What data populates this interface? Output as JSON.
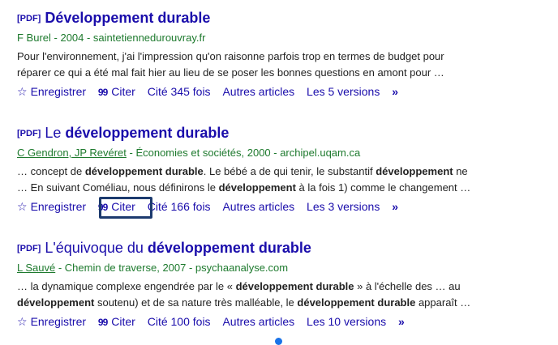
{
  "results": [
    {
      "pdf_tag": "[PDF]",
      "title_bold": "Développement durable",
      "meta_authors": "F Burel",
      "meta_rest": " - 2004 - saintetiennedurouvray.fr",
      "snippet_line1": "Pour l'environnement, j'ai l'impression qu'on raisonne parfois trop en termes de budget pour",
      "snippet_line2": "réparer ce qui a été mal fait hier au lieu de se poser les bonnes questions en amont pour …",
      "actions": {
        "save": "Enregistrer",
        "cite": "Citer",
        "cited_by": "Cité 345 fois",
        "related": "Autres articles",
        "versions": "Les 5 versions"
      }
    },
    {
      "pdf_tag": "[PDF]",
      "title_pre": "Le ",
      "title_bold": "développement durable",
      "meta_authors": "C Gendron, JP Revéret",
      "meta_rest": " - Économies et sociétés, 2000 - archipel.uqam.ca",
      "snippet_l1_a": "… concept de ",
      "snippet_l1_b": "développement durable",
      "snippet_l1_c": ". Le bébé a de qui tenir, le substantif ",
      "snippet_l1_d": "développement",
      "snippet_l1_e": " ne",
      "snippet_l2_a": "… En suivant Coméliau, nous définirons le ",
      "snippet_l2_b": "développement",
      "snippet_l2_c": " à la fois 1) comme le changement …",
      "actions": {
        "save": "Enregistrer",
        "cite": "Citer",
        "cited_by": "Cité 166 fois",
        "related": "Autres articles",
        "versions": "Les 3 versions"
      }
    },
    {
      "pdf_tag": "[PDF]",
      "title_pre": "L'équivoque du ",
      "title_bold": "développement durable",
      "meta_authors": "L Sauvé",
      "meta_rest": " - Chemin de traverse, 2007 - psychaanalyse.com",
      "snippet_l1_a": "… la dynamique complexe engendrée par le « ",
      "snippet_l1_b": "développement durable",
      "snippet_l1_c": " » à l'échelle des … au",
      "snippet_l2_a": "développement",
      "snippet_l2_b": " soutenu) et de sa nature très malléable, le ",
      "snippet_l2_c": "développement durable",
      "snippet_l2_d": " apparaît …",
      "actions": {
        "save": "Enregistrer",
        "cite": "Citer",
        "cited_by": "Cité 100 fois",
        "related": "Autres articles",
        "versions": "Les 10 versions"
      }
    }
  ],
  "icons": {
    "star": "☆",
    "quote": "99",
    "more": "»"
  },
  "colors": {
    "link": "#1a0dab",
    "meta": "#1e7a2e",
    "focus_outline": "#1c3a6e",
    "indicator": "#1a73e8"
  }
}
